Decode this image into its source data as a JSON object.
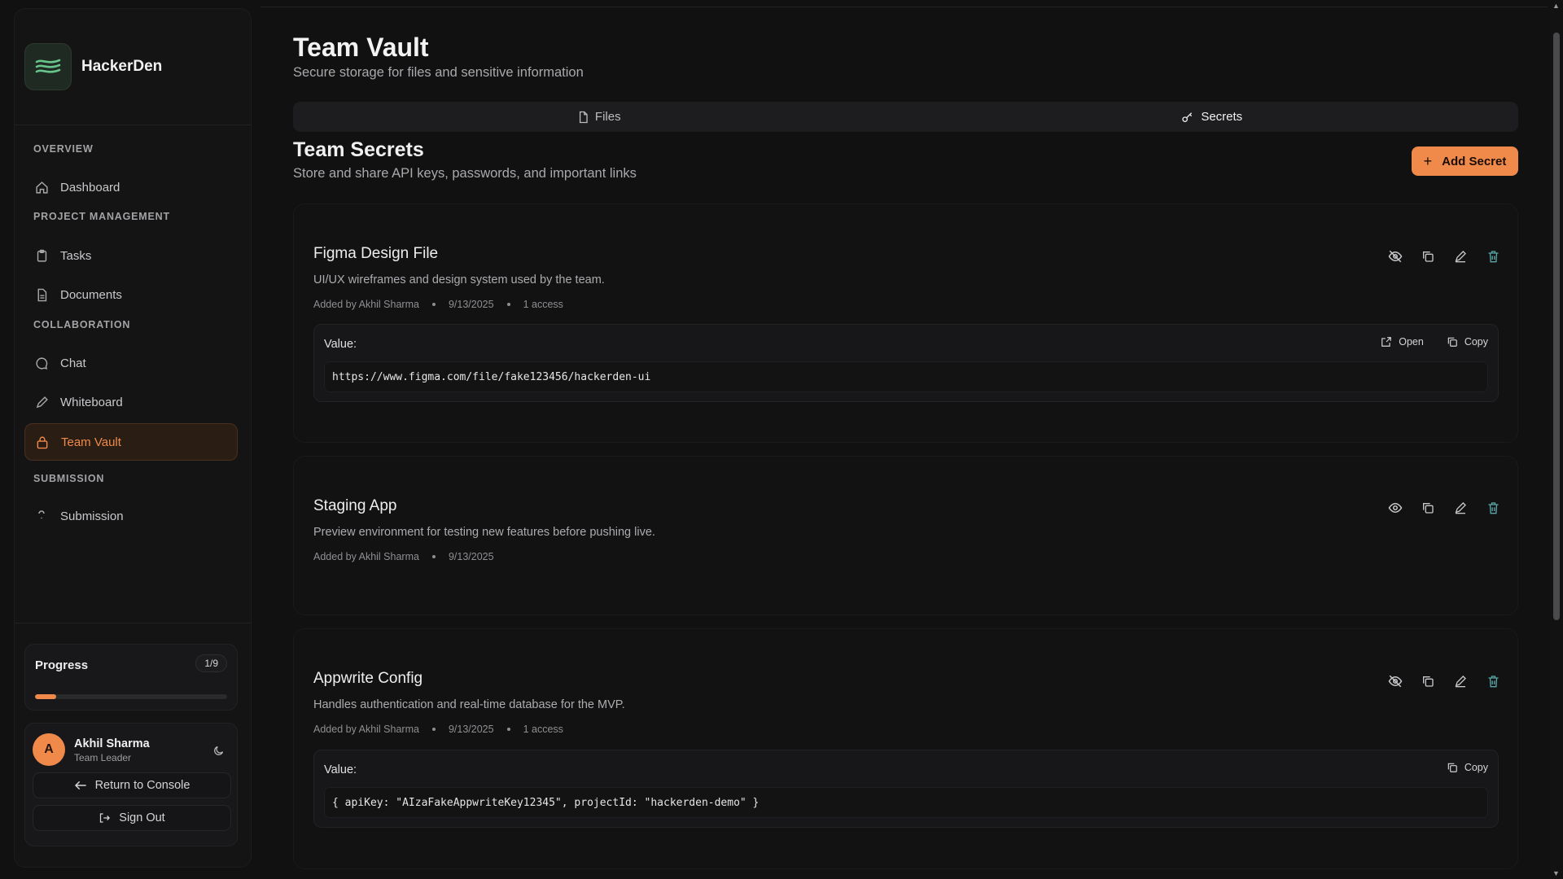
{
  "brand": {
    "name": "HackerDen"
  },
  "nav": {
    "sections": [
      {
        "label": "OVERVIEW"
      },
      {
        "label": "PROJECT MANAGEMENT"
      },
      {
        "label": "COLLABORATION"
      },
      {
        "label": "SUBMISSION"
      }
    ],
    "items": [
      {
        "label": "Dashboard",
        "icon": "home-icon"
      },
      {
        "label": "Tasks",
        "icon": "clipboard-icon"
      },
      {
        "label": "Documents",
        "icon": "document-icon"
      },
      {
        "label": "Chat",
        "icon": "chat-icon"
      },
      {
        "label": "Whiteboard",
        "icon": "pencil-icon"
      },
      {
        "label": "Team Vault",
        "icon": "lock-icon",
        "active": true
      },
      {
        "label": "Submission",
        "icon": "submission-icon"
      }
    ]
  },
  "progress": {
    "label": "Progress",
    "count": "1/9",
    "fraction": 0.111
  },
  "user": {
    "initial": "A",
    "name": "Akhil Sharma",
    "role": "Team Leader",
    "return_label": "Return to Console",
    "signout_label": "Sign Out"
  },
  "page": {
    "title": "Team Vault",
    "subtitle": "Secure storage for files and sensitive information",
    "tabs": [
      {
        "label": "Files",
        "icon": "file-icon"
      },
      {
        "label": "Secrets",
        "icon": "key-icon",
        "active": true
      }
    ]
  },
  "secrets": {
    "title": "Team Secrets",
    "subtitle": "Store and share API keys, passwords, and important links",
    "add_label": "Add Secret",
    "value_label": "Value:",
    "open_label": "Open",
    "copy_label": "Copy",
    "items": [
      {
        "title": "Figma Design File",
        "description": "UI/UX wireframes and design system used by the team.",
        "added_by": "Added by Akhil Sharma",
        "date": "9/13/2025",
        "access": "1 access",
        "value": "https://www.figma.com/file/fake123456/hackerden-ui"
      },
      {
        "title": "Staging App",
        "description": "Preview environment for testing new features before pushing live.",
        "added_by": "Added by Akhil Sharma",
        "date": "9/13/2025"
      },
      {
        "title": "Appwrite Config",
        "description": "Handles authentication and real-time database for the MVP.",
        "added_by": "Added by Akhil Sharma",
        "date": "9/13/2025",
        "access": "1 access",
        "value": "{ apiKey: \"AIzaFakeAppwriteKey12345\", projectId: \"hackerden-demo\" }"
      }
    ]
  },
  "colors": {
    "accent": "#f08a4b",
    "background": "#111112"
  }
}
